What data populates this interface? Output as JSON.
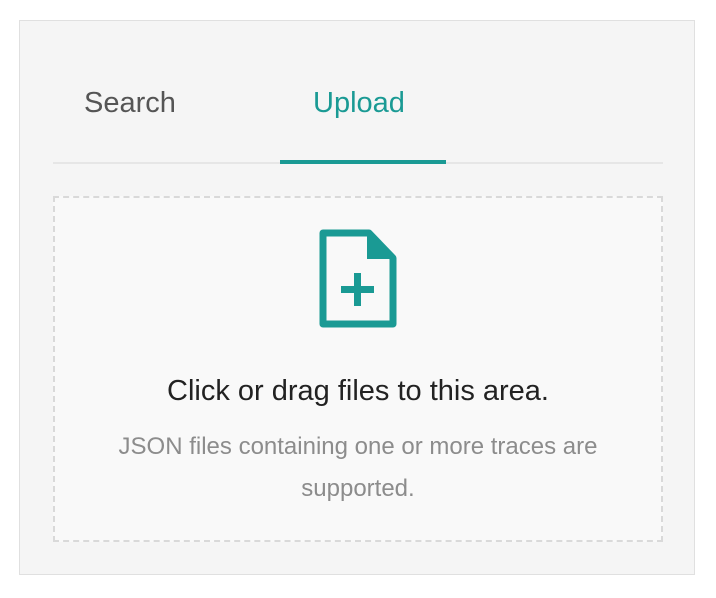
{
  "tabs": [
    {
      "label": "Search",
      "active": false
    },
    {
      "label": "Upload",
      "active": true
    }
  ],
  "dropzone": {
    "icon": "file-add-icon",
    "title": "Click or drag files to this area.",
    "hint": "JSON files containing one or more traces are supported."
  },
  "colors": {
    "accent": "#1a9a94",
    "panel_bg": "#f5f5f5",
    "dropzone_bg": "#f9f9f9",
    "hint_text": "#8c8c8c"
  }
}
